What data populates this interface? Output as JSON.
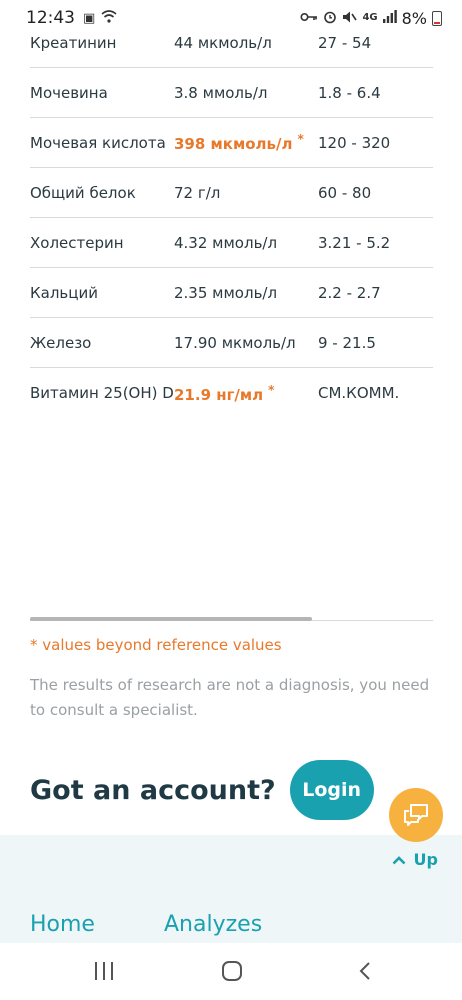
{
  "status_bar": {
    "time": "12:43",
    "battery": "8%"
  },
  "results": [
    {
      "name": "Креатинин",
      "value": "44 мкмоль/л",
      "flag": "",
      "ref": "27 - 54",
      "abnormal": false
    },
    {
      "name": "Мочевина",
      "value": "3.8 ммоль/л",
      "flag": "",
      "ref": "1.8 - 6.4",
      "abnormal": false
    },
    {
      "name": "Мочевая кислота",
      "value": "398 мкмоль/л",
      "flag": "*",
      "ref": "120 - 320",
      "abnormal": true
    },
    {
      "name": "Общий белок",
      "value": "72 г/л",
      "flag": "",
      "ref": "60 - 80",
      "abnormal": false
    },
    {
      "name": "Холестерин",
      "value": "4.32 ммоль/л",
      "flag": "",
      "ref": "3.21 - 5.2",
      "abnormal": false
    },
    {
      "name": "Кальций",
      "value": "2.35 ммоль/л",
      "flag": "",
      "ref": "2.2 - 2.7",
      "abnormal": false
    },
    {
      "name": "Железо",
      "value": "17.90 мкмоль/л",
      "flag": "",
      "ref": "9 - 21.5",
      "abnormal": false
    },
    {
      "name": "Витамин 25(OH) D",
      "value": "21.9 нг/мл",
      "flag": "*",
      "ref": "СМ.КОММ.",
      "abnormal": true
    }
  ],
  "notes": {
    "beyond_reference": "* values beyond reference values",
    "disclaimer": "The results of research are not a diagnosis, you need to consult a specialist."
  },
  "account": {
    "question": "Got an account?",
    "login_label": "Login"
  },
  "up_label": "Up",
  "footer_nav": {
    "home": "Home",
    "analyzes": "Analyzes"
  },
  "colors": {
    "accent": "#1aa1b0",
    "warning": "#e8792b",
    "fab": "#f7b13f",
    "heading": "#1f3a44"
  },
  "icons": {
    "chat_fab": "chat-bubbles-icon",
    "up": "chevron-up-icon"
  }
}
